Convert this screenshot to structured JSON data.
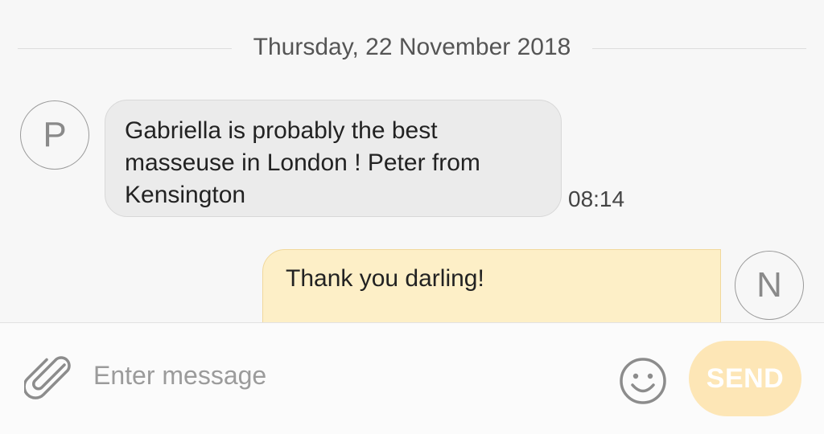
{
  "thread": {
    "date_separator": "Thursday, 22 November 2018",
    "messages": [
      {
        "direction": "incoming",
        "avatar_letter": "P",
        "text": "Gabriella is probably the best masseuse in London ! Peter from Kensington",
        "time": "08:14"
      },
      {
        "direction": "outgoing",
        "avatar_letter": "N",
        "text": "Thank you darling!"
      }
    ]
  },
  "composer": {
    "placeholder": "Enter message",
    "send_label": "SEND",
    "attach_icon": "paperclip-icon",
    "emoji_icon": "smiley-icon"
  },
  "colors": {
    "incoming_bubble": "#ebebeb",
    "outgoing_bubble": "#fdefc7",
    "send_button": "#fde6b6"
  }
}
